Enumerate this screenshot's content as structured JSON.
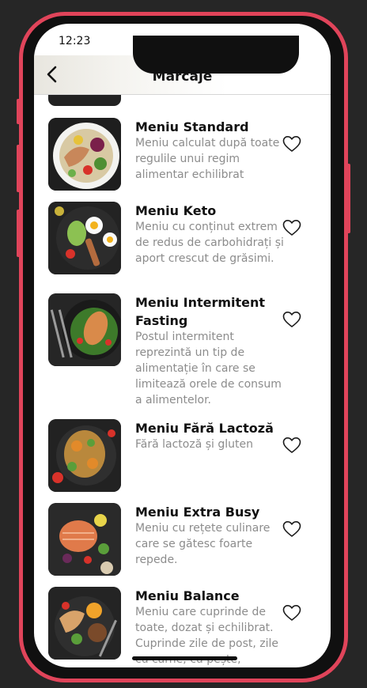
{
  "status_bar": {
    "time": "12:23"
  },
  "header": {
    "title": "Marcaje",
    "back_icon": "chevron-left-icon"
  },
  "items": [
    {
      "name": "Meniu Standard",
      "description": "Meniu calculat după toate regulile unui regim alimentar echilibrat",
      "icon": "heart-outline-icon"
    },
    {
      "name": "Meniu Keto",
      "description": "Meniu cu conținut extrem de redus de carbohidrați și aport crescut de grăsimi.",
      "icon": "heart-outline-icon"
    },
    {
      "name": "Meniu Intermitent Fasting",
      "description": "Postul intermitent reprezintă un tip de alimentație în care se limitează orele de consum a alimentelor.",
      "icon": "heart-outline-icon"
    },
    {
      "name": "Meniu Fără Lactoză",
      "description": "Fără lactoză și gluten",
      "icon": "heart-outline-icon"
    },
    {
      "name": "Meniu Extra Busy",
      "description": "Meniu cu rețete culinare care se gătesc foarte repede.",
      "icon": "heart-outline-icon"
    },
    {
      "name": "Meniu Balance",
      "description": "Meniu care cuprinde de toate, dozat și echilibrat. Cuprinde zile de post, zile cu carne, cu pește,",
      "icon": "heart-outline-icon"
    }
  ],
  "colors": {
    "frame_accent": "#e0445a",
    "background": "#262626",
    "description_text": "#8c8c8c"
  }
}
